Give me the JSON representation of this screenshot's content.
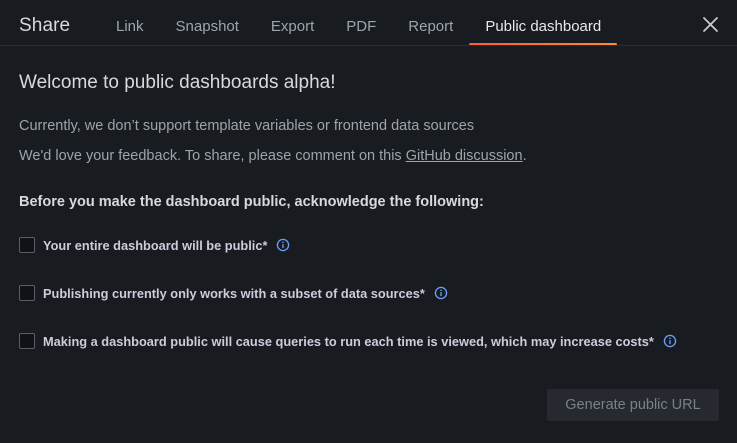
{
  "header": {
    "title": "Share",
    "tabs": [
      {
        "label": "Link"
      },
      {
        "label": "Snapshot"
      },
      {
        "label": "Export"
      },
      {
        "label": "PDF"
      },
      {
        "label": "Report"
      },
      {
        "label": "Public dashboard",
        "active": true
      }
    ],
    "close_icon": "close-icon"
  },
  "main": {
    "heading": "Welcome to public dashboards alpha!",
    "paragraph1": "Currently, we don’t support template variables or frontend data sources",
    "paragraph2_prefix": "We'd love your feedback. To share, please comment on this ",
    "paragraph2_link": "GitHub discussion",
    "paragraph2_suffix": ".",
    "ack_heading": "Before you make the dashboard public, acknowledge the following:",
    "acknowledgements": [
      {
        "label": "Your entire dashboard will be public*",
        "checked": false,
        "icon": "info-circle-icon"
      },
      {
        "label": "Publishing currently only works with a subset of data sources*",
        "checked": false,
        "icon": "info-circle-icon"
      },
      {
        "label": "Making a dashboard public will cause queries to run each time is viewed, which may increase costs*",
        "checked": false,
        "icon": "info-circle-icon"
      }
    ],
    "generate_button": "Generate public URL"
  },
  "colors": {
    "background": "#181b1f",
    "accent_start": "#f55f3e",
    "accent_end": "#ff8833",
    "info_icon": "#6e9fff"
  }
}
